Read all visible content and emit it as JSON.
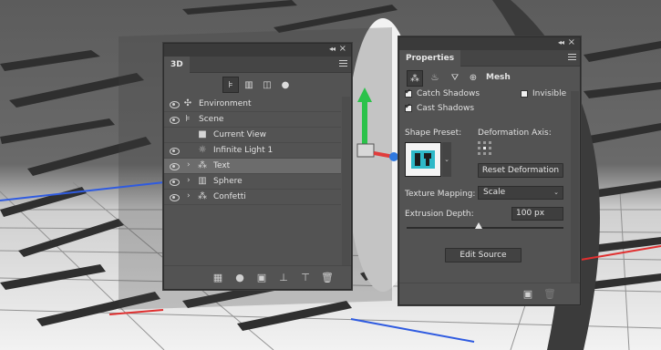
{
  "panel_3d": {
    "title": "3D",
    "filter_icons": [
      "scene-filter-icon",
      "mesh-filter-icon",
      "material-filter-icon",
      "light-filter-icon"
    ],
    "items": [
      {
        "label": "Environment",
        "icon": "environment-icon",
        "visible": true
      },
      {
        "label": "Scene",
        "icon": "scene-icon",
        "visible": true
      },
      {
        "label": "Current View",
        "icon": "camera-icon",
        "visible": false
      },
      {
        "label": "Infinite Light 1",
        "icon": "light-icon",
        "visible": true
      },
      {
        "label": "Text",
        "icon": "mesh-icon",
        "visible": true,
        "selected": true
      },
      {
        "label": "Sphere",
        "icon": "mesh-icon",
        "visible": true
      },
      {
        "label": "Confetti",
        "icon": "mesh-icon",
        "visible": true
      }
    ],
    "bottom_icons": [
      "render-icon",
      "light-add-icon",
      "new-object-icon",
      "move-to-ground-icon",
      "clone-icon",
      "trash-icon"
    ]
  },
  "properties": {
    "title": "Properties",
    "tab_mesh": "Mesh",
    "catch_shadows": "Catch Shadows",
    "invisible": "Invisible",
    "cast_shadows": "Cast Shadows",
    "shape_preset_label": "Shape Preset:",
    "deformation_axis_label": "Deformation Axis:",
    "reset_deformation": "Reset Deformation",
    "texture_mapping_label": "Texture Mapping:",
    "texture_mapping_value": "Scale",
    "extrusion_depth_label": "Extrusion Depth:",
    "extrusion_depth_value": "100 px",
    "extrusion_depth_slider": 0.46,
    "edit_source": "Edit Source",
    "catch_shadows_checked": true,
    "cast_shadows_checked": true,
    "invisible_checked": false
  },
  "colors": {
    "panel_bg": "#535353",
    "selected_row": "#6c6c6c",
    "gizmo_green": "#2bc24a",
    "gizmo_red": "#e03c3c",
    "gizmo_blue": "#2f79e0"
  }
}
